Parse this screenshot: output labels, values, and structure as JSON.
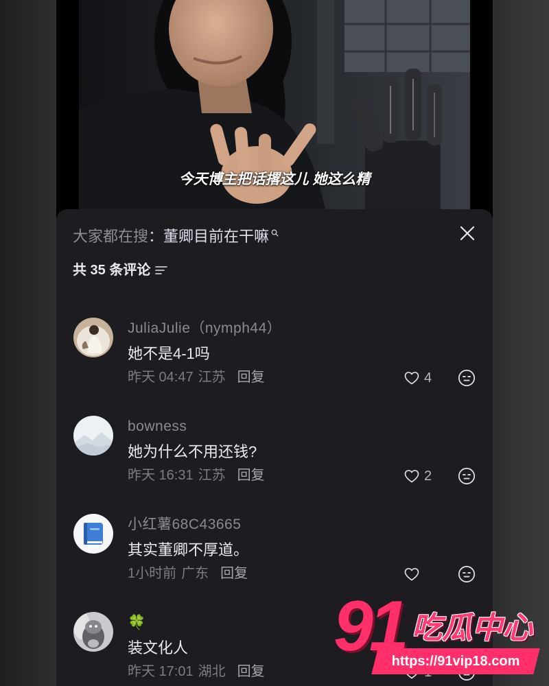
{
  "video": {
    "subtitle": "今天博主把话撂这儿 她这么精"
  },
  "panel": {
    "search_hint": {
      "label": "大家都在搜",
      "separator": "：",
      "query": "董卿目前在干嘛"
    },
    "comment_count_label": "共 35 条评论",
    "comments": [
      {
        "username": "JuliaJulie（nymph44）",
        "text": "她不是4-1吗",
        "time": "昨天 04:47",
        "location": "江苏",
        "reply_label": "回复",
        "like_count": "4"
      },
      {
        "username": "bowness",
        "text": "她为什么不用还钱?",
        "time": "昨天 16:31",
        "location": "江苏",
        "reply_label": "回复",
        "like_count": "2"
      },
      {
        "username": "小红薯68C43665",
        "text": "其实董卿不厚道。",
        "time": "1小时前",
        "location": "广东",
        "reply_label": "回复",
        "like_count": ""
      },
      {
        "username": "🍀",
        "text": "装文化人",
        "time": "昨天 17:01",
        "location": "湖北",
        "reply_label": "回复",
        "like_count": "1"
      }
    ]
  },
  "watermark": {
    "number": "91",
    "name": "吃瓜中心",
    "url": "https://91vip18.com"
  },
  "icons": {
    "close": "close-icon",
    "search": "search-icon",
    "sort": "sort-icon",
    "like": "heart-icon",
    "dislike": "meh-face-icon",
    "avatar_3": "book-icon"
  },
  "colors": {
    "panel_background": "#1c1c21",
    "primary_text": "#ececee",
    "secondary_text": "#8a8a91",
    "watermark_pink": "#ff2f6c"
  }
}
